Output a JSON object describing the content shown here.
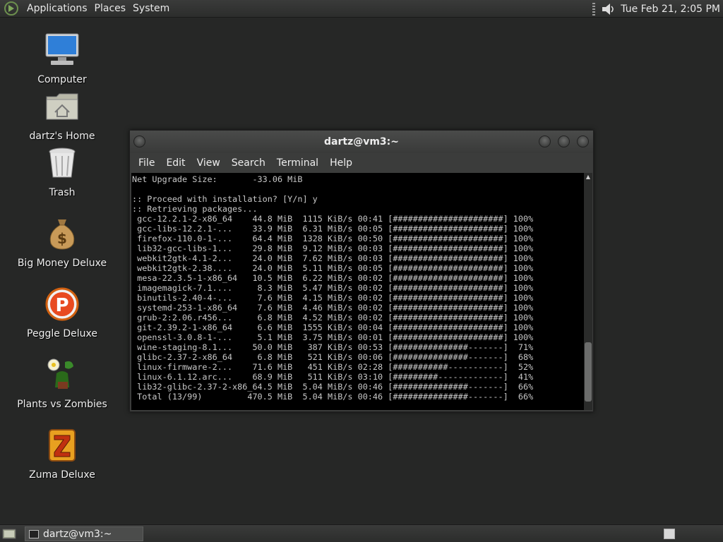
{
  "top_panel": {
    "menus": [
      "Applications",
      "Places",
      "System"
    ],
    "clock": "Tue Feb 21,  2:05 PM"
  },
  "desktop_icons": [
    {
      "label": "Computer",
      "icon": "computer-icon"
    },
    {
      "label": "dartz's Home",
      "icon": "home-folder-icon"
    },
    {
      "label": "Trash",
      "icon": "trash-icon"
    },
    {
      "label": "Big Money Deluxe",
      "icon": "money-bag-icon"
    },
    {
      "label": "Peggle Deluxe",
      "icon": "peggle-icon"
    },
    {
      "label": "Plants vs Zombies",
      "icon": "plants-vs-zombies-icon"
    },
    {
      "label": "Zuma Deluxe",
      "icon": "zuma-icon"
    }
  ],
  "terminal": {
    "title": "dartz@vm3:~",
    "menu": [
      "File",
      "Edit",
      "View",
      "Search",
      "Terminal",
      "Help"
    ],
    "lines": [
      "Net Upgrade Size:       -33.06 MiB",
      "",
      ":: Proceed with installation? [Y/n] y",
      ":: Retrieving packages...",
      " gcc-12.2.1-2-x86_64    44.8 MiB  1115 KiB/s 00:41 [######################] 100%",
      " gcc-libs-12.2.1-...    33.9 MiB  6.31 MiB/s 00:05 [######################] 100%",
      " firefox-110.0-1-...    64.4 MiB  1328 KiB/s 00:50 [######################] 100%",
      " lib32-gcc-libs-1...    29.8 MiB  9.12 MiB/s 00:03 [######################] 100%",
      " webkit2gtk-4.1-2...    24.0 MiB  7.62 MiB/s 00:03 [######################] 100%",
      " webkit2gtk-2.38....    24.0 MiB  5.11 MiB/s 00:05 [######################] 100%",
      " mesa-22.3.5-1-x86_64   10.5 MiB  6.22 MiB/s 00:02 [######################] 100%",
      " imagemagick-7.1....     8.3 MiB  5.47 MiB/s 00:02 [######################] 100%",
      " binutils-2.40-4-...     7.6 MiB  4.15 MiB/s 00:02 [######################] 100%",
      " systemd-253-1-x86_64    7.6 MiB  4.46 MiB/s 00:02 [######################] 100%",
      " grub-2:2.06.r456...     6.8 MiB  4.52 MiB/s 00:02 [######################] 100%",
      " git-2.39.2-1-x86_64     6.6 MiB  1555 KiB/s 00:04 [######################] 100%",
      " openssl-3.0.8-1-...     5.1 MiB  3.75 MiB/s 00:01 [######################] 100%",
      " wine-staging-8.1...    50.0 MiB   387 KiB/s 00:53 [###############-------]  71%",
      " glibc-2.37-2-x86_64     6.8 MiB   521 KiB/s 00:06 [###############-------]  68%",
      " linux-firmware-2...    71.6 MiB   451 KiB/s 02:28 [###########-----------]  52%",
      " linux-6.1.12.arc...    68.9 MiB   511 KiB/s 03:10 [#########-------------]  41%",
      " lib32-glibc-2.37-2-x86_64.5 MiB  5.04 MiB/s 00:46 [###############-------]  66%",
      " Total (13/99)         470.5 MiB  5.04 MiB/s 00:46 [###############-------]  66%"
    ]
  },
  "bottom_panel": {
    "task_label": "dartz@vm3:~"
  }
}
